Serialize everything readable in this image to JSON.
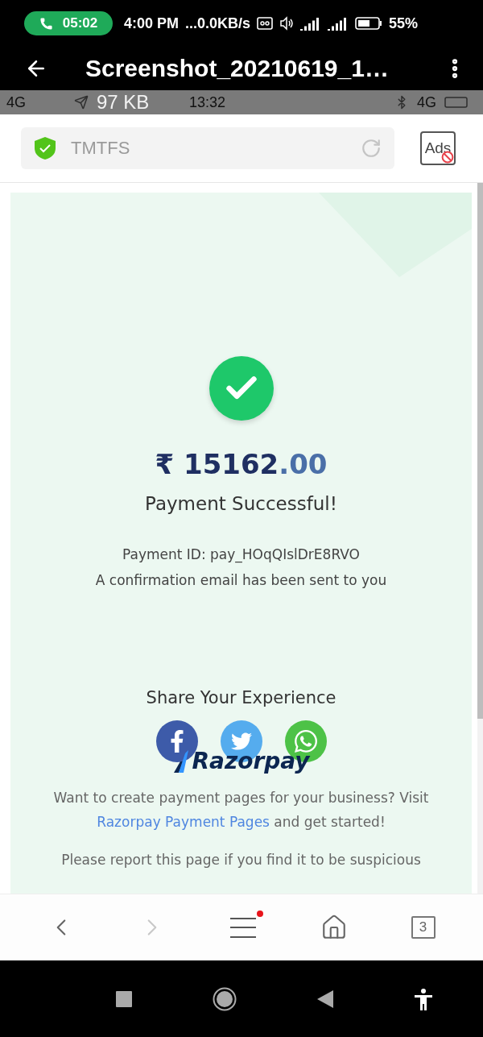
{
  "status_bar": {
    "call_time": "05:02",
    "time": "4:00 PM",
    "network_speed": "...0.0KB/s",
    "battery": "55%"
  },
  "title_bar": {
    "title": "Screenshot_20210619_1…",
    "subtitle": "97 KB"
  },
  "captured_status_bar": {
    "network_left": "4G",
    "time": "13:32",
    "network_right": "4G"
  },
  "browser_bar": {
    "site": "TMTFS",
    "ads_label": "Ads"
  },
  "page": {
    "amount_main": "₹ 15162",
    "amount_decimal": ".00",
    "status_text": "Payment Successful!",
    "payment_id": "Payment ID: pay_HOqQIslDrE8RVO",
    "confirmation": "A confirmation email has been sent to you",
    "share_heading": "Share Your Experience",
    "logo_text": "Razorpay",
    "promo_text": "Want to create payment pages for your business? Visit",
    "promo_link": "Razorpay Payment Pages",
    "promo_suffix": "and get started!",
    "report_text": "Please report this page if you find it to be suspicious"
  },
  "bottom_nav": {
    "back_disabled": false,
    "forward_disabled": true,
    "menu_badge": true,
    "tab_count": "3"
  }
}
